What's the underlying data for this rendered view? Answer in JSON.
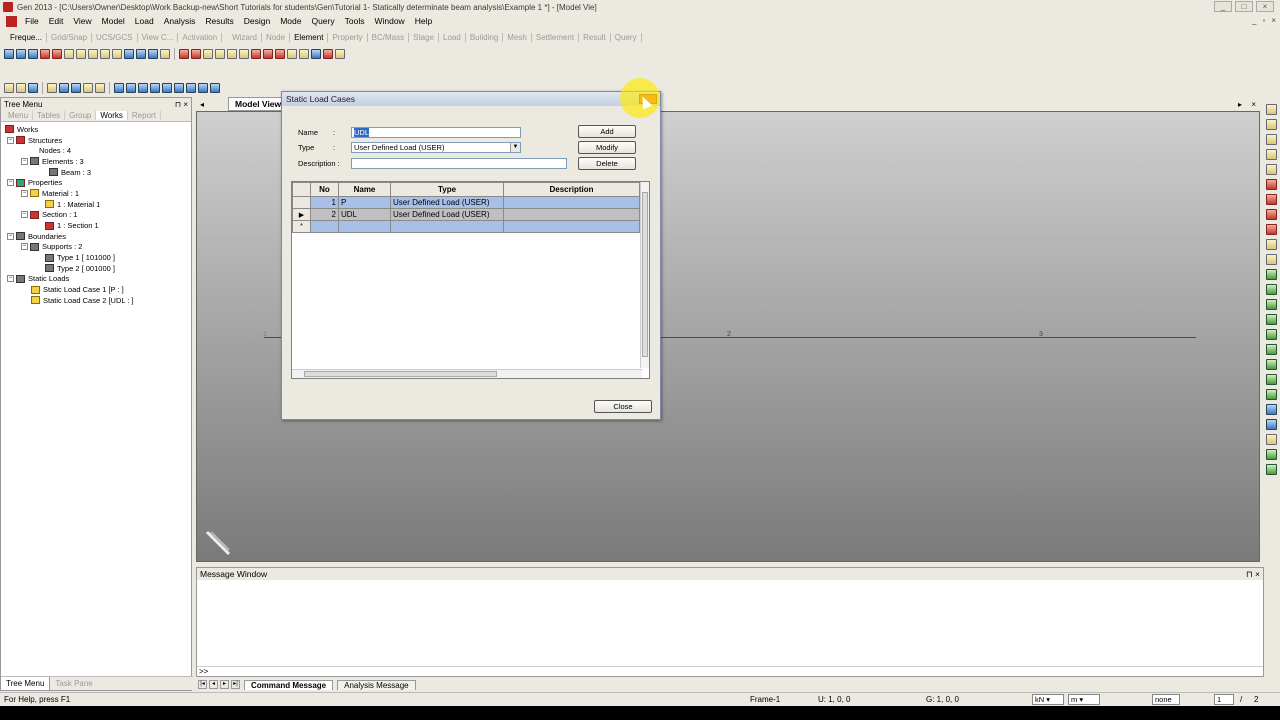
{
  "window": {
    "title": "Gen 2013 - [C:\\Users\\Owner\\Desktop\\Work Backup-new\\Short Tutorials for students\\Gen\\Tutorial 1- Statically determinate beam analysis\\Example 1 *] - [Model Vie]"
  },
  "menu": [
    "File",
    "Edit",
    "View",
    "Model",
    "Load",
    "Analysis",
    "Results",
    "Design",
    "Mode",
    "Query",
    "Tools",
    "Window",
    "Help"
  ],
  "ribbon_tabs_left": [
    "Freque...",
    "Grid/Snap",
    "UCS/GCS",
    "View C...",
    "Activation"
  ],
  "ribbon_tabs_right": [
    "Wizard",
    "Node",
    "Element",
    "Property",
    "BC/Mass",
    "Stage",
    "Load",
    "Building",
    "Mesh",
    "Settlement",
    "Result",
    "Query"
  ],
  "tree_pane": {
    "title": "Tree Menu",
    "tabs": [
      "Menu",
      "Tables",
      "Group",
      "Works",
      "Report"
    ],
    "active_tab": "Works",
    "items": [
      {
        "label": "Works"
      },
      {
        "label": "Structures"
      },
      {
        "label": "Nodes : 4"
      },
      {
        "label": "Elements : 3"
      },
      {
        "label": "Beam : 3"
      },
      {
        "label": "Properties"
      },
      {
        "label": "Material : 1"
      },
      {
        "label": "1 : Material 1"
      },
      {
        "label": "Section : 1"
      },
      {
        "label": "1 : Section 1"
      },
      {
        "label": "Boundaries"
      },
      {
        "label": "Supports : 2"
      },
      {
        "label": "Type 1 [ 101000 ]"
      },
      {
        "label": "Type 2 [ 001000 ]"
      },
      {
        "label": "Static Loads"
      },
      {
        "label": "Static Load Case 1 [P : ]"
      },
      {
        "label": "Static Load Case 2 [UDL : ]"
      }
    ],
    "bottom_tabs": [
      "Tree Menu",
      "Task Pane"
    ]
  },
  "view": {
    "tab_label": "Model View",
    "node_labels": [
      "1",
      "2",
      "3"
    ]
  },
  "dialog": {
    "title": "Static Load Cases",
    "name_label": "Name",
    "name_value": "UDL",
    "type_label": "Type",
    "type_value": "User Defined Load (USER)",
    "description_label": "Description :",
    "description_value": "",
    "colon": ":",
    "buttons": {
      "add": "Add",
      "modify": "Modify",
      "delete": "Delete",
      "close": "Close"
    },
    "table": {
      "headers": [
        "No",
        "Name",
        "Type",
        "Description"
      ],
      "rows": [
        {
          "no": "1",
          "name": "P",
          "type": "User Defined Load (USER)",
          "description": ""
        },
        {
          "no": "2",
          "name": "UDL",
          "type": "User Defined Load (USER)",
          "description": ""
        }
      ],
      "new_row_marker": "*"
    }
  },
  "message_window": {
    "title": "Message Window",
    "prompt": ">>",
    "tabs": [
      "Command Message",
      "Analysis Message"
    ]
  },
  "status": {
    "help": "For Help, press F1",
    "frame": "Frame-1",
    "u": "U: 1, 0, 0",
    "g": "G: 1, 0, 0",
    "force_unit": "kN",
    "length_unit": "m",
    "filter": "none",
    "page": "1",
    "page_total": "2"
  }
}
